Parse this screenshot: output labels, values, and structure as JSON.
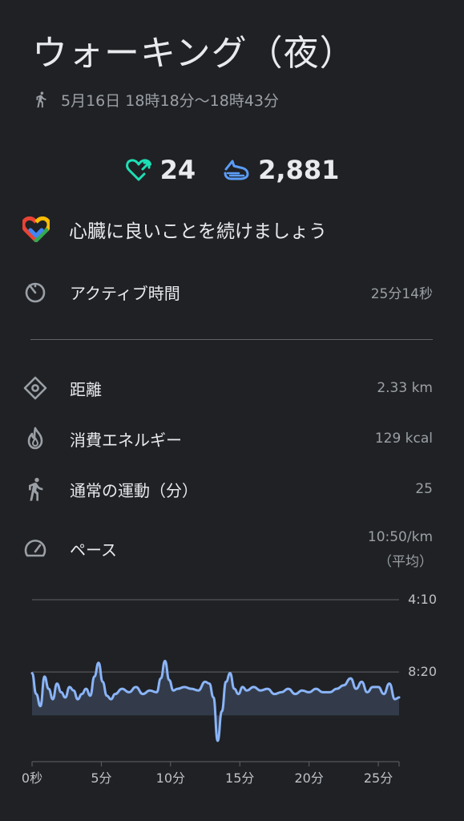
{
  "header": {
    "title": "ウォーキング（夜）",
    "datetime": "5月16日 18時18分〜18時43分"
  },
  "metrics": {
    "heart_points": "24",
    "steps": "2,881",
    "heart_color": "#1ddfb6",
    "steps_color": "#5b9df9"
  },
  "motivation": "心臓に良いことを続けましょう",
  "stats": {
    "active_time": {
      "label": "アクティブ時間",
      "value": "25分14秒"
    },
    "distance": {
      "label": "距離",
      "value": "2.33 km"
    },
    "energy": {
      "label": "消費エネルギー",
      "value": "129 kcal"
    },
    "move_minutes": {
      "label": "通常の運動（分）",
      "value": "25"
    },
    "pace": {
      "label": "ペース",
      "value": "10:50/km",
      "sub": "（平均）"
    }
  },
  "chart_data": {
    "type": "line",
    "xlabel": "",
    "ylabel": "",
    "x_ticks": [
      "0秒",
      "5分",
      "10分",
      "15分",
      "20分",
      "25分"
    ],
    "y_ticks": [
      "4:10",
      "8:20"
    ],
    "x_unit": "minutes",
    "y_unit": "min per km",
    "x_range": [
      0,
      26.5
    ],
    "y_range": [
      4.17,
      13.5
    ],
    "average": 10.83,
    "line_color": "#8ab4f8",
    "x": [
      0,
      0.3,
      0.6,
      0.9,
      1.2,
      1.5,
      1.8,
      2.1,
      2.4,
      2.7,
      3.0,
      3.3,
      3.6,
      3.9,
      4.2,
      4.5,
      4.8,
      5.1,
      5.4,
      5.7,
      6.0,
      6.5,
      7.0,
      7.5,
      8.0,
      8.5,
      9.0,
      9.3,
      9.6,
      9.9,
      10.2,
      10.5,
      11.0,
      11.5,
      12.0,
      12.5,
      12.8,
      13.1,
      13.4,
      13.7,
      14.0,
      14.3,
      14.6,
      14.9,
      15.2,
      15.5,
      16.0,
      16.5,
      17.0,
      17.5,
      18.0,
      18.5,
      19.0,
      19.5,
      20.0,
      20.5,
      21.0,
      21.5,
      22.0,
      22.5,
      23.0,
      23.4,
      23.8,
      24.2,
      24.6,
      25.0,
      25.4,
      25.8,
      26.2,
      26.5
    ],
    "y": [
      8.4,
      9.6,
      10.3,
      8.6,
      9.3,
      9.9,
      9.0,
      9.5,
      9.8,
      9.2,
      9.4,
      9.9,
      9.6,
      9.3,
      9.7,
      8.6,
      7.8,
      8.9,
      9.7,
      9.9,
      9.6,
      9.3,
      9.5,
      9.2,
      9.6,
      9.4,
      9.5,
      8.7,
      7.7,
      8.8,
      9.4,
      9.3,
      9.2,
      9.3,
      9.4,
      8.9,
      9.0,
      9.8,
      12.3,
      10.6,
      8.9,
      8.4,
      9.3,
      9.6,
      9.2,
      9.4,
      9.2,
      9.4,
      9.3,
      9.6,
      9.5,
      9.3,
      9.6,
      9.4,
      9.5,
      9.3,
      9.5,
      9.5,
      9.3,
      9.1,
      8.7,
      9.3,
      8.9,
      9.5,
      9.2,
      9.2,
      9.6,
      9.0,
      9.9,
      9.8
    ]
  }
}
